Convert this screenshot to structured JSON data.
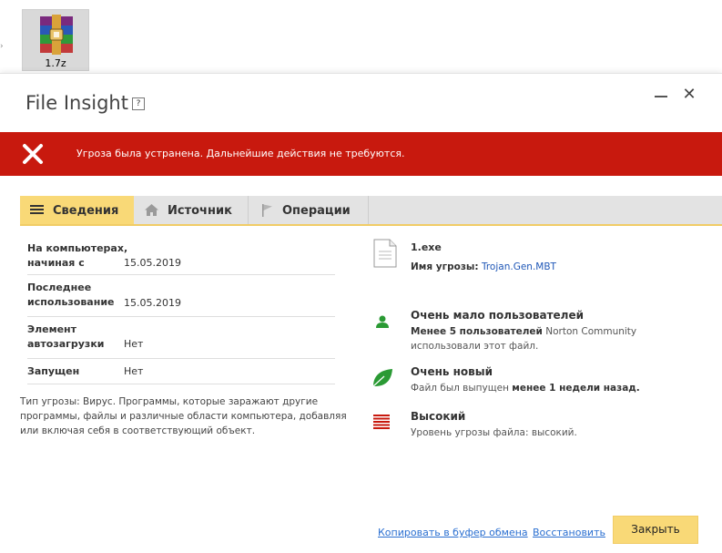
{
  "desktop": {
    "file_label": "1.7z"
  },
  "window": {
    "title": "File Insight",
    "help_label": "?",
    "close_glyph": "✕"
  },
  "alert": {
    "message": "Угроза была устранена. Дальнейшие действия не требуются.",
    "color": "#c8190e"
  },
  "tabs": [
    {
      "label": "Сведения",
      "icon": "list-icon",
      "active": true
    },
    {
      "label": "Источник",
      "icon": "home-icon",
      "active": false
    },
    {
      "label": "Операции",
      "icon": "flag-icon",
      "active": false
    }
  ],
  "details": [
    {
      "label_line1": "На компьютерах,",
      "label_line2": "начиная с",
      "value": "15.05.2019"
    },
    {
      "label_line1": "Последнее",
      "label_line2": "использование",
      "value": "15.05.2019"
    },
    {
      "label_line1": "Элемент",
      "label_line2": "автозагрузки",
      "value": "Нет"
    },
    {
      "label_line1": "Запущен",
      "label_line2": "",
      "value": "Нет"
    }
  ],
  "threat_description": "Тип угрозы: Вирус. Программы, которые заражают другие программы, файлы и различные области компьютера, добавляя или включая себя в соответствующий объект.",
  "file_info": {
    "name": "1.exe",
    "threat_label": "Имя угрозы:",
    "threat_name": "Trojan.Gen.MBT"
  },
  "stats": {
    "users": {
      "title": "Очень мало пользователей",
      "bold": "Менее 5 пользователей",
      "text1": " Norton Community",
      "text2": "использовали этот файл.",
      "icon": "user-icon"
    },
    "age": {
      "title": "Очень новый",
      "text_before": "Файл был выпущен ",
      "bold": "менее 1 недели назад.",
      "icon": "leaf-icon"
    },
    "risk": {
      "title": "Высокий",
      "text": "Уровень угрозы файла: высокий.",
      "icon": "risk-bars-icon"
    }
  },
  "footer": {
    "copy_link": "Копировать в буфер обмена",
    "restore_link": "Восстановить",
    "close_button": "Закрыть"
  },
  "colors": {
    "accent_yellow": "#f9d977",
    "link_blue": "#2a6fd1",
    "green": "#2a9a34",
    "risk_red": "#c8190e"
  }
}
